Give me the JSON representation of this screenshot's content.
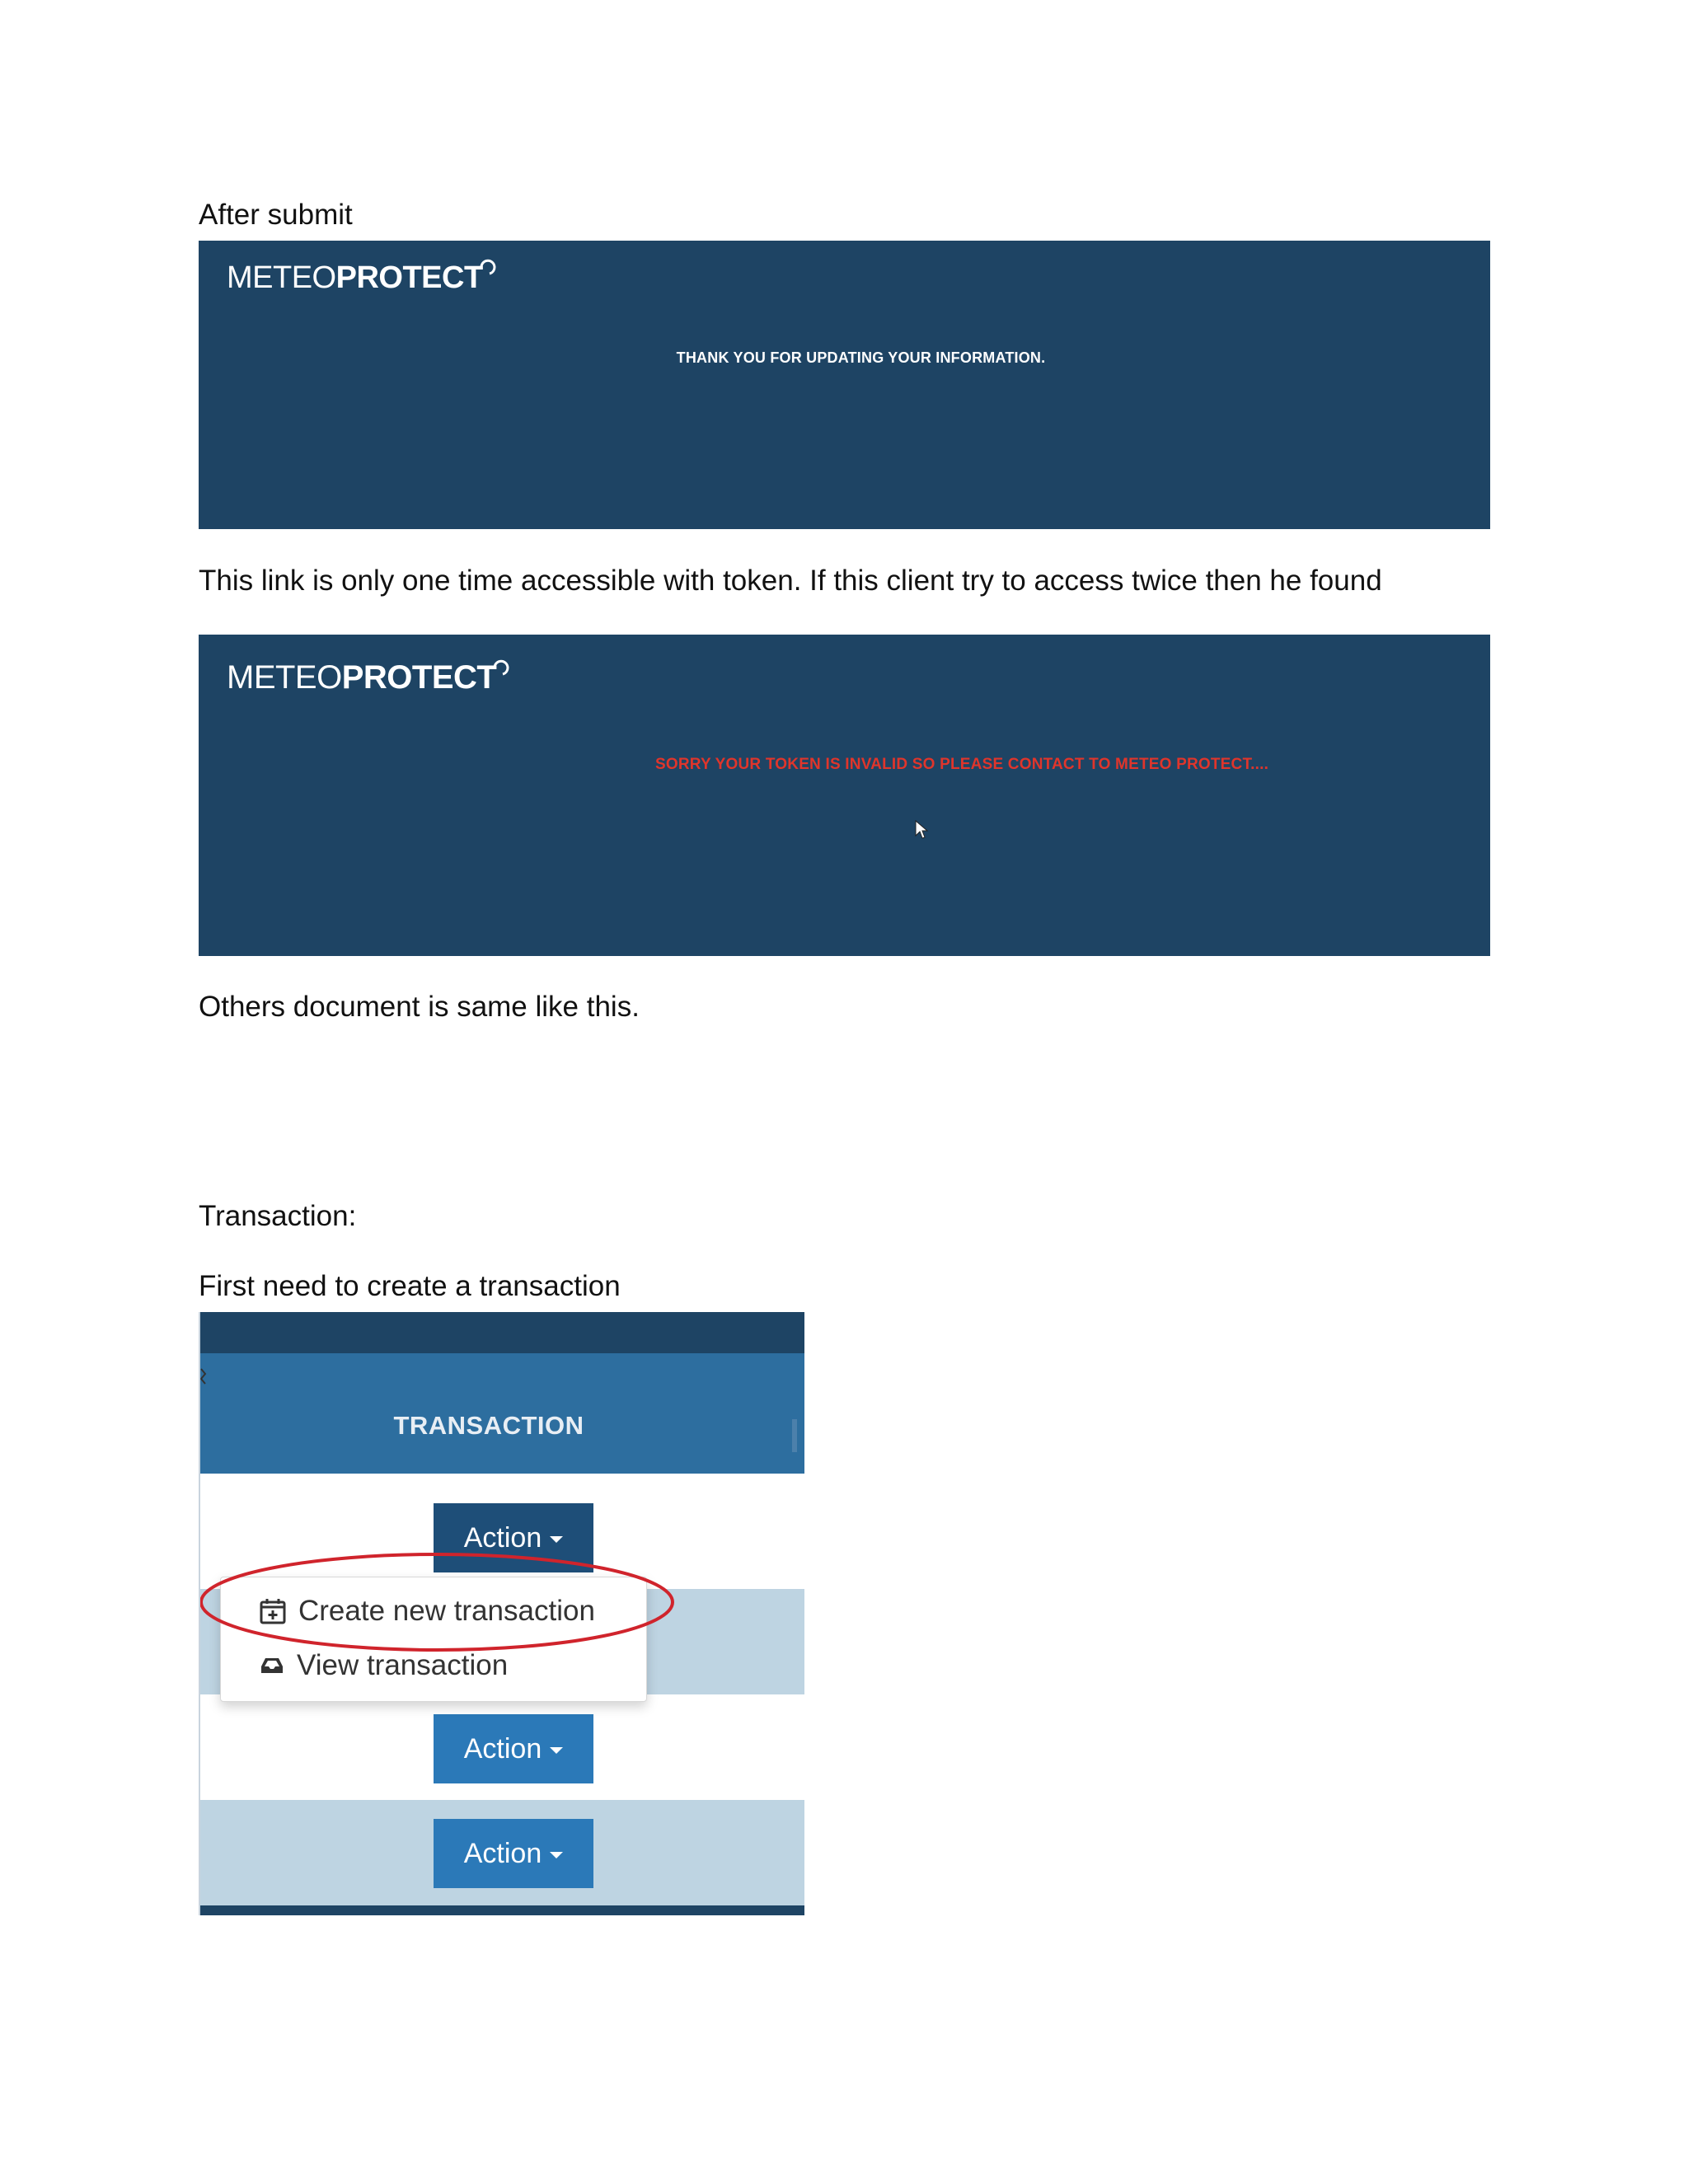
{
  "paragraphs": {
    "after_submit": "After submit",
    "one_time_link": "This link is only one time accessible with token. If this client try to access twice then he found",
    "others_same": "Others document is same like this.",
    "transaction_heading": "Transaction:",
    "first_create": "First need to create a transaction"
  },
  "panel_success": {
    "logo_light": "METEO",
    "logo_bold": "PROTECT",
    "message": "THANK YOU FOR UPDATING YOUR INFORMATION."
  },
  "panel_invalid": {
    "logo_light": "METEO",
    "logo_bold": "PROTECT",
    "message": "SORRY YOUR TOKEN IS INVALID SO PLEASE CONTACT TO METEO PROTECT....",
    "message_color": "#e0352b"
  },
  "transaction": {
    "header_title": "TRANSACTION",
    "action_label": "Action",
    "menu": {
      "create_label": "Create new transaction",
      "create_icon": "calendar-plus-icon",
      "view_label": "View transaction",
      "view_icon": "inbox-icon"
    },
    "highlight_color": "#d0242c"
  },
  "colors": {
    "panel_bg": "#1e4464",
    "header_bg": "#2d6e9f",
    "row_blue": "#bed4e2",
    "button_dark": "#1e4e78",
    "button_light": "#2b79b8"
  }
}
